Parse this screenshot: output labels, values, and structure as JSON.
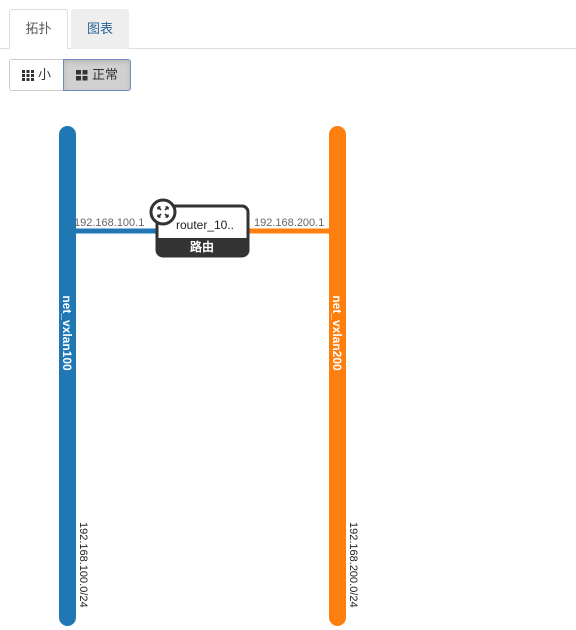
{
  "tabs": [
    {
      "label": "拓扑",
      "active": true
    },
    {
      "label": "图表",
      "active": false
    }
  ],
  "view_toggle": {
    "small_label": "小",
    "normal_label": "正常",
    "small_icon": "th-icon",
    "normal_icon": "th-large-icon"
  },
  "networks": [
    {
      "name": "net_vxlan100",
      "cidr": "192.168.100.0/24",
      "color": "#1f77b4"
    },
    {
      "name": "net_vxlan200",
      "cidr": "192.168.200.0/24",
      "color": "#ff7f0e"
    }
  ],
  "router": {
    "name": "router_10..",
    "type_label": "路由",
    "icon": "router-icon",
    "ports": [
      {
        "ip": "192.168.100.1",
        "network": "net_vxlan100"
      },
      {
        "ip": "192.168.200.1",
        "network": "net_vxlan200"
      }
    ]
  }
}
